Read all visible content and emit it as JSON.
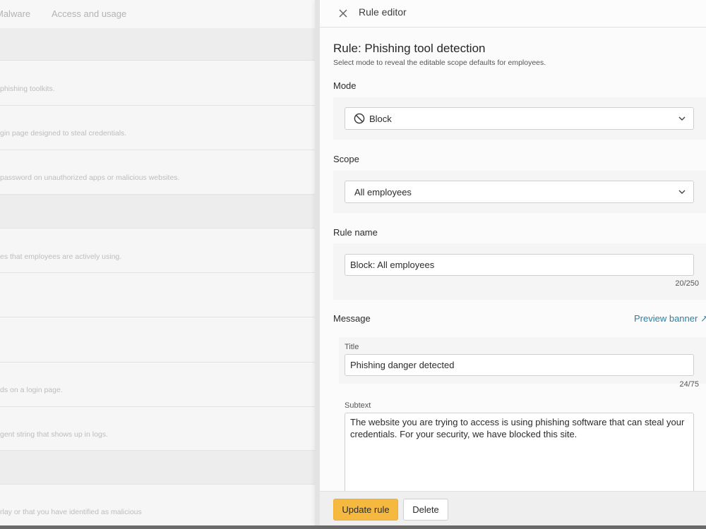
{
  "background": {
    "tabs": [
      "Malware",
      "Access and usage"
    ],
    "rows": [
      "phishing toolkits.",
      "gin page designed to steal credentials.",
      "password on unauthorized apps or malicious websites.",
      "es that employees are actively using.",
      "ds on a login page.",
      "gent string that shows up in logs.",
      "rlay or that you have identified as malicious"
    ]
  },
  "drawer": {
    "title": "Rule editor",
    "rule_title": "Rule: Phishing tool detection",
    "rule_subtitle": "Select mode to reveal the editable scope defaults for employees.",
    "mode": {
      "label": "Mode",
      "value": "Block",
      "icon": "ban-icon"
    },
    "scope": {
      "label": "Scope",
      "value": "All employees"
    },
    "rule_name": {
      "label": "Rule name",
      "value": "Block: All employees",
      "counter": "20/250"
    },
    "message": {
      "label": "Message",
      "preview_link": "Preview banner ↗",
      "title_label": "Title",
      "title_value": "Phishing danger detected",
      "title_counter": "24/75",
      "subtext_label": "Subtext",
      "subtext_value": "The website you are trying to access is using phishing software that can steal your credentials. For your security, we have blocked this site."
    },
    "footer": {
      "primary": "Update rule",
      "secondary": "Delete"
    }
  },
  "colors": {
    "primary_button": "#f6b940",
    "link": "#2e7ea3"
  }
}
